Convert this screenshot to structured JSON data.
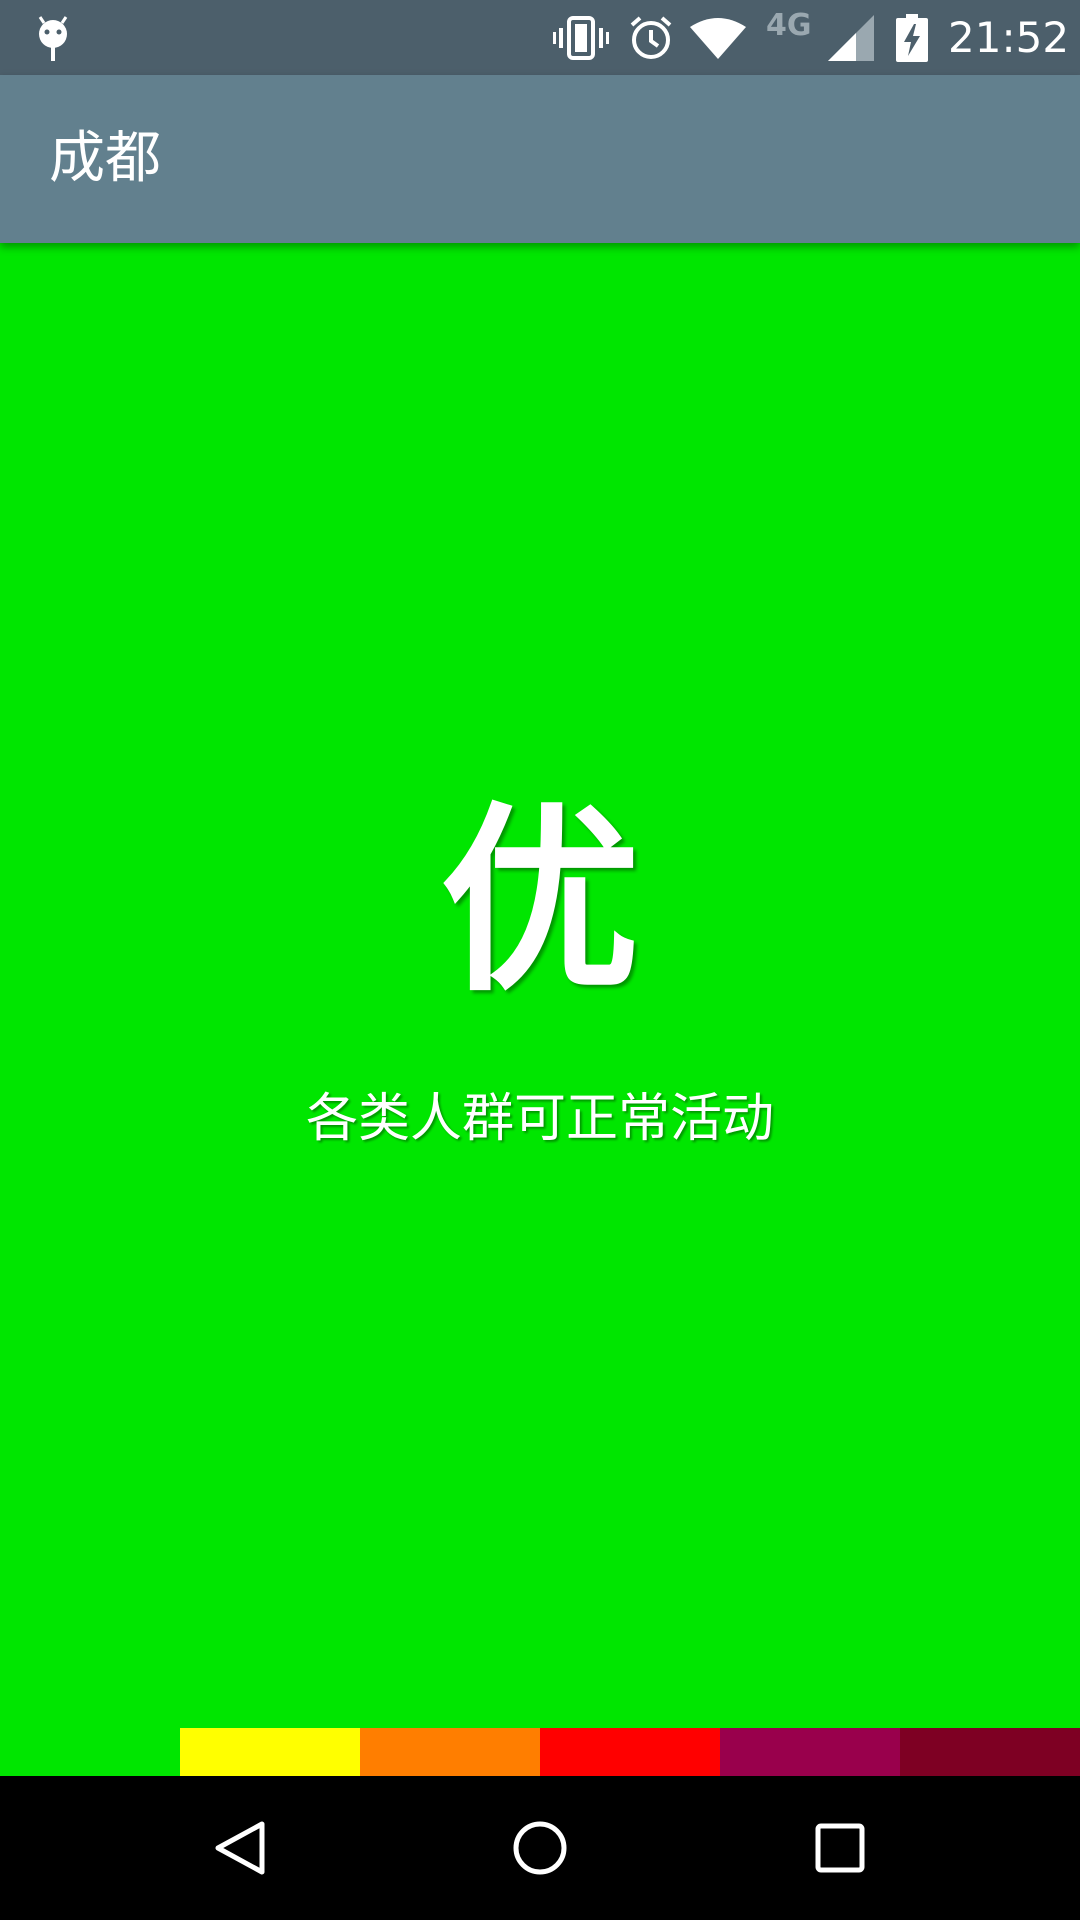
{
  "status_bar": {
    "time": "21:52",
    "network": "4G",
    "icons": [
      "android-debug-icon",
      "vibrate-icon",
      "alarm-icon",
      "wifi-icon",
      "signal-icon",
      "battery-charging-icon"
    ]
  },
  "app_bar": {
    "title": "成都",
    "color": "#62808e"
  },
  "air_quality": {
    "level": "优",
    "advice": "各类人群可正常活动",
    "background_color": "#00e600"
  },
  "scale": {
    "segments": [
      {
        "color": "#00e600"
      },
      {
        "color": "#ffff00"
      },
      {
        "color": "#ff7e00"
      },
      {
        "color": "#ff0000"
      },
      {
        "color": "#99004c"
      },
      {
        "color": "#7e0023"
      }
    ]
  },
  "nav_bar": {
    "buttons": [
      "back-icon",
      "home-icon",
      "recents-icon"
    ]
  }
}
